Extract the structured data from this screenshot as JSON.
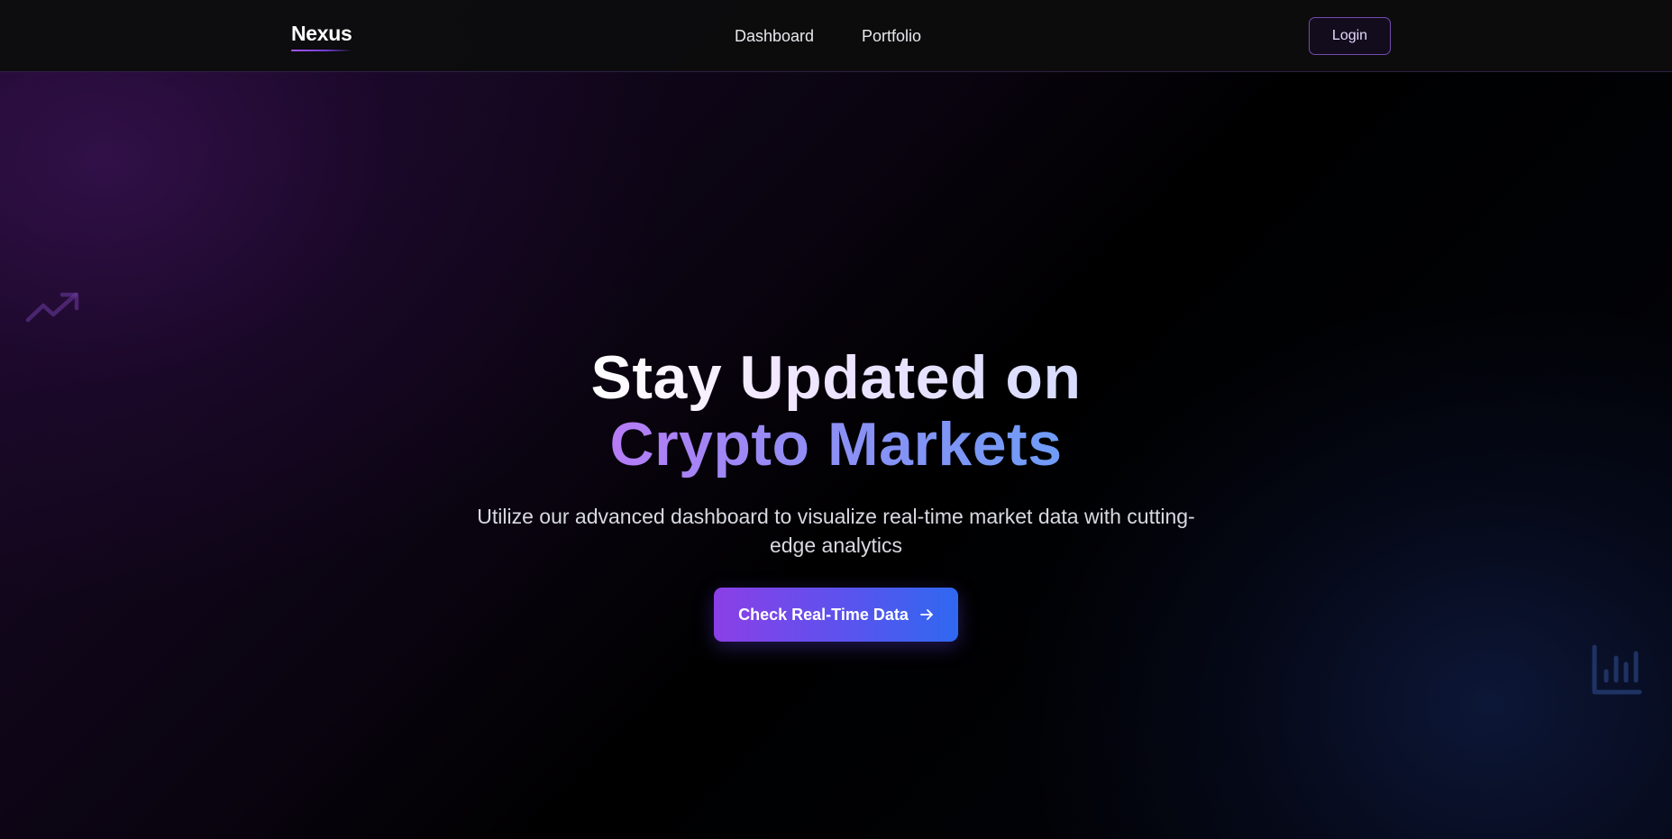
{
  "header": {
    "brand": "Nexus",
    "nav": [
      {
        "label": "Dashboard"
      },
      {
        "label": "Portfolio"
      }
    ],
    "login_label": "Login"
  },
  "hero": {
    "title_line1": "Stay Updated on",
    "title_line2": "Crypto Markets",
    "subtitle": "Utilize our advanced dashboard to visualize real-time market data with cutting-edge analytics",
    "cta_label": "Check Real-Time Data",
    "cta_icon": "arrow-right-icon"
  },
  "decorations": {
    "left_icon": "trending-up-icon",
    "right_icon": "bar-chart-icon"
  },
  "colors": {
    "accent_purple": "#8b3fe6",
    "accent_blue": "#2f68f0",
    "header_bg": "#0c0c0e",
    "background": "#000000"
  }
}
